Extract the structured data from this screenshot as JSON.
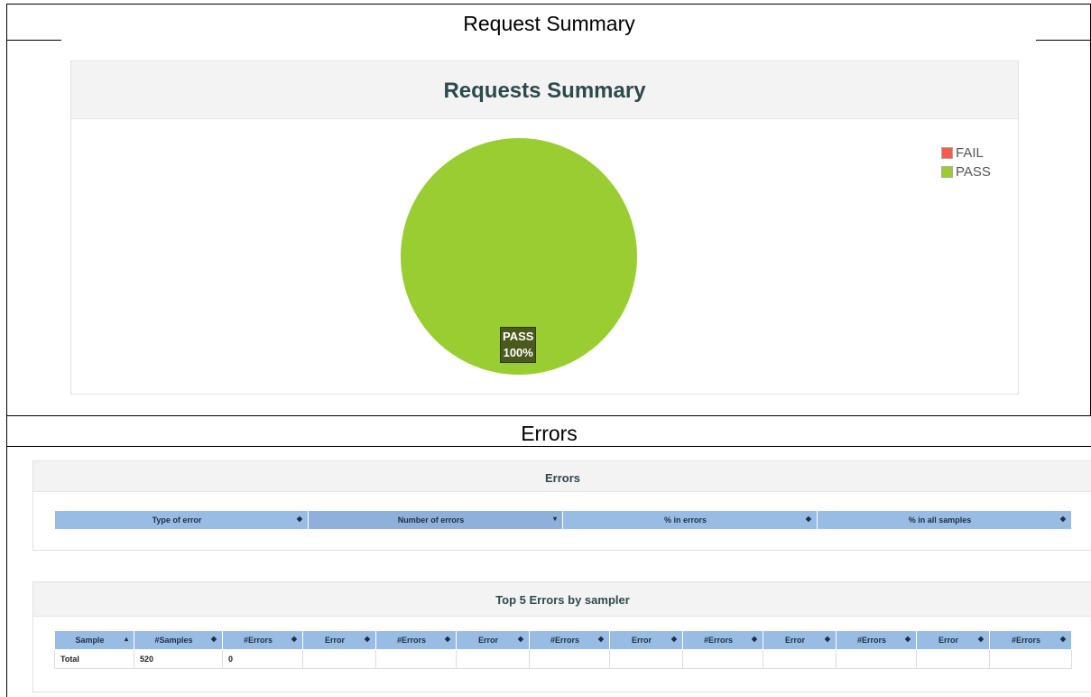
{
  "sections": {
    "request_summary_title": "Request Summary",
    "errors_title": "Errors"
  },
  "requests_panel": {
    "title": "Requests Summary",
    "legend": [
      {
        "label": "FAIL",
        "color": "#f45b4f"
      },
      {
        "label": "PASS",
        "color": "#9acd32"
      }
    ],
    "slice_label_name": "PASS",
    "slice_label_pct": "100%"
  },
  "chart_data": {
    "type": "pie",
    "title": "Requests Summary",
    "categories": [
      "FAIL",
      "PASS"
    ],
    "values": [
      0,
      100
    ],
    "colors": [
      "#f45b4f",
      "#9acd32"
    ],
    "legend_position": "top-right"
  },
  "errors_panel": {
    "title": "Errors",
    "columns": [
      "Type of error",
      "Number of errors",
      "% in errors",
      "% in all samples"
    ],
    "sort_icons": [
      "◆",
      "▾",
      "◆",
      "◆"
    ]
  },
  "top5_panel": {
    "title": "Top 5 Errors by sampler",
    "columns": [
      "Sample",
      "#Samples",
      "#Errors",
      "Error",
      "#Errors",
      "Error",
      "#Errors",
      "Error",
      "#Errors",
      "Error",
      "#Errors",
      "Error",
      "#Errors"
    ],
    "sort_icons": [
      "▴",
      "◆",
      "◆",
      "◆",
      "◆",
      "◆",
      "◆",
      "◆",
      "◆",
      "◆",
      "◆",
      "◆",
      "◆"
    ],
    "rows": [
      [
        "Total",
        "520",
        "0",
        "",
        "",
        "",
        "",
        "",
        "",
        "",
        "",
        "",
        ""
      ]
    ]
  }
}
